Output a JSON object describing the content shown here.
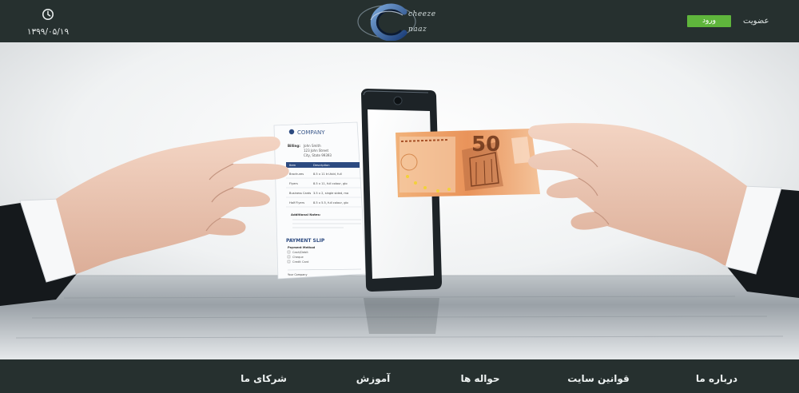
{
  "header": {
    "date": "۱۳۹۹/۰۵/۱۹",
    "clock_icon": "clock-icon",
    "logo": {
      "line1": "cheeze",
      "line2": "naaz"
    },
    "login_label": "ورود",
    "signup_label": "عضویت",
    "colors": {
      "background": "#26302f",
      "login_button": "#5fb53c"
    }
  },
  "hero": {
    "invoice": {
      "company": "COMPANY",
      "billing_label": "Billing:",
      "billing_lines": [
        "John Smith",
        "123 John Street",
        "City, State 99393"
      ],
      "table_headers": [
        "Item",
        "Description"
      ],
      "rows": [
        [
          "Brochures",
          "8.5 x 11 tri-fold, full"
        ],
        [
          "Flyers",
          "8.5 x 11, full colour, glo"
        ],
        [
          "Business Cards",
          "3.5 x 2, single sided, ma"
        ],
        [
          "Half Flyers",
          "8.5 x 5.5, full colour, glo"
        ]
      ],
      "notes_title": "Additional Notes:",
      "payment_title": "PAYMENT SLIP",
      "payment_method": "Payment Method",
      "payment_options": [
        "Cash/Debit",
        "Cheque",
        "Credit Card"
      ],
      "footer_text": "Your Company"
    },
    "banknote_value": "50"
  },
  "footer": {
    "nav": [
      {
        "label": "درباره ما"
      },
      {
        "label": "قوانین سایت"
      },
      {
        "label": "حواله ها"
      },
      {
        "label": "آموزش"
      },
      {
        "label": "شرکای ما"
      }
    ]
  }
}
